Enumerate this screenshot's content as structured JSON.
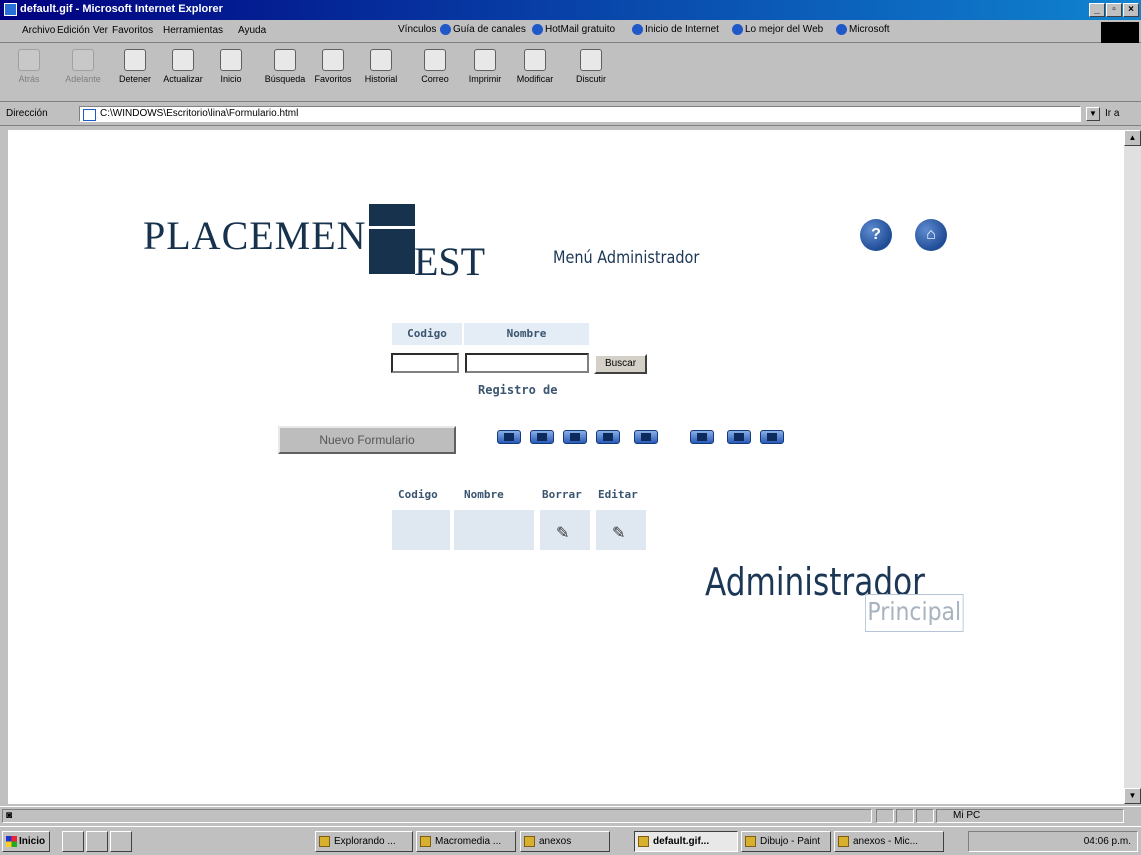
{
  "window": {
    "title": "default.gif - Microsoft Internet Explorer"
  },
  "menu": [
    "Archivo",
    "Edición",
    "Ver",
    "Favoritos",
    "Herramientas",
    "Ayuda"
  ],
  "links": {
    "label": "Vínculos",
    "items": [
      "Guía de canales",
      "HotMail gratuito",
      "Inicio de Internet",
      "Lo mejor del Web",
      "Microsoft"
    ]
  },
  "toolbar": {
    "buttons": [
      {
        "label": "Atrás",
        "icon": "back-arrow-icon"
      },
      {
        "label": "Adelante",
        "icon": "forward-arrow-icon"
      },
      {
        "label": "Detener",
        "icon": "stop-icon"
      },
      {
        "label": "Actualizar",
        "icon": "refresh-icon"
      },
      {
        "label": "Inicio",
        "icon": "home-icon"
      },
      {
        "label": "Búsqueda",
        "icon": "search-icon"
      },
      {
        "label": "Favoritos",
        "icon": "favorites-icon"
      },
      {
        "label": "Historial",
        "icon": "history-icon"
      },
      {
        "label": "Correo",
        "icon": "mail-icon"
      },
      {
        "label": "Imprimir",
        "icon": "print-icon"
      },
      {
        "label": "Modificar",
        "icon": "edit-icon"
      },
      {
        "label": "Discutir",
        "icon": "discuss-icon"
      }
    ]
  },
  "address": {
    "label": "Dirección",
    "value": "C:\\WINDOWS\\Escritorio\\lina\\Formulario.html",
    "go": "Ir a"
  },
  "page": {
    "logo_placemen": "PLACEMEN",
    "logo_t": "T",
    "logo_est": "EST",
    "menu_title": "Menú Administrador",
    "search": {
      "col_codigo": "Codigo",
      "col_nombre": "Nombre",
      "codigo_value": "",
      "nombre_value": "",
      "buscar": "Buscar"
    },
    "registro": "Registro de",
    "nuevo": "Nuevo Formulario",
    "results": {
      "headers": [
        "Codigo",
        "Nombre",
        "Borrar",
        "Editar"
      ]
    },
    "admin_title": "Administrador",
    "admin_sub": "Principal"
  },
  "status": {
    "zone": "Mi PC"
  },
  "taskbar": {
    "start": "Inicio",
    "tasks": [
      "Explorando ...",
      "Macromedia ...",
      "anexos",
      "default.gif...",
      "Dibujo - Paint",
      "anexos - Mic..."
    ],
    "clock": "04:06 p.m."
  }
}
